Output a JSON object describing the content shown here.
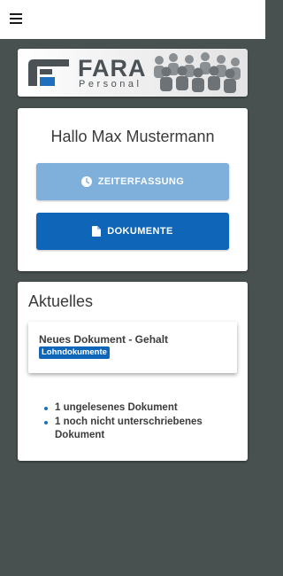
{
  "header": {
    "menu_icon": "hamburger-menu-icon"
  },
  "logo": {
    "brand": "FARA",
    "sub": "Personal"
  },
  "welcome": {
    "title": "Hallo Max Mustermann",
    "buttons": [
      {
        "label": "ZEITERFASSUNG",
        "icon": "clock-icon",
        "color": "#7fb0db"
      },
      {
        "label": "DOKUMENTE",
        "icon": "document-icon",
        "color": "#0f65b8"
      }
    ]
  },
  "news": {
    "title": "Aktuelles",
    "items": [
      {
        "title": "Neues Dokument - Gehalt",
        "badge": "Lohndokumente"
      }
    ],
    "summary": [
      "1 ungelesenes Dokument",
      "1 noch nicht unterschriebenes Dokument"
    ]
  },
  "colors": {
    "background": "#485050",
    "primary": "#0f65b8",
    "primary_light": "#7fb0db",
    "card": "#ffffff"
  }
}
